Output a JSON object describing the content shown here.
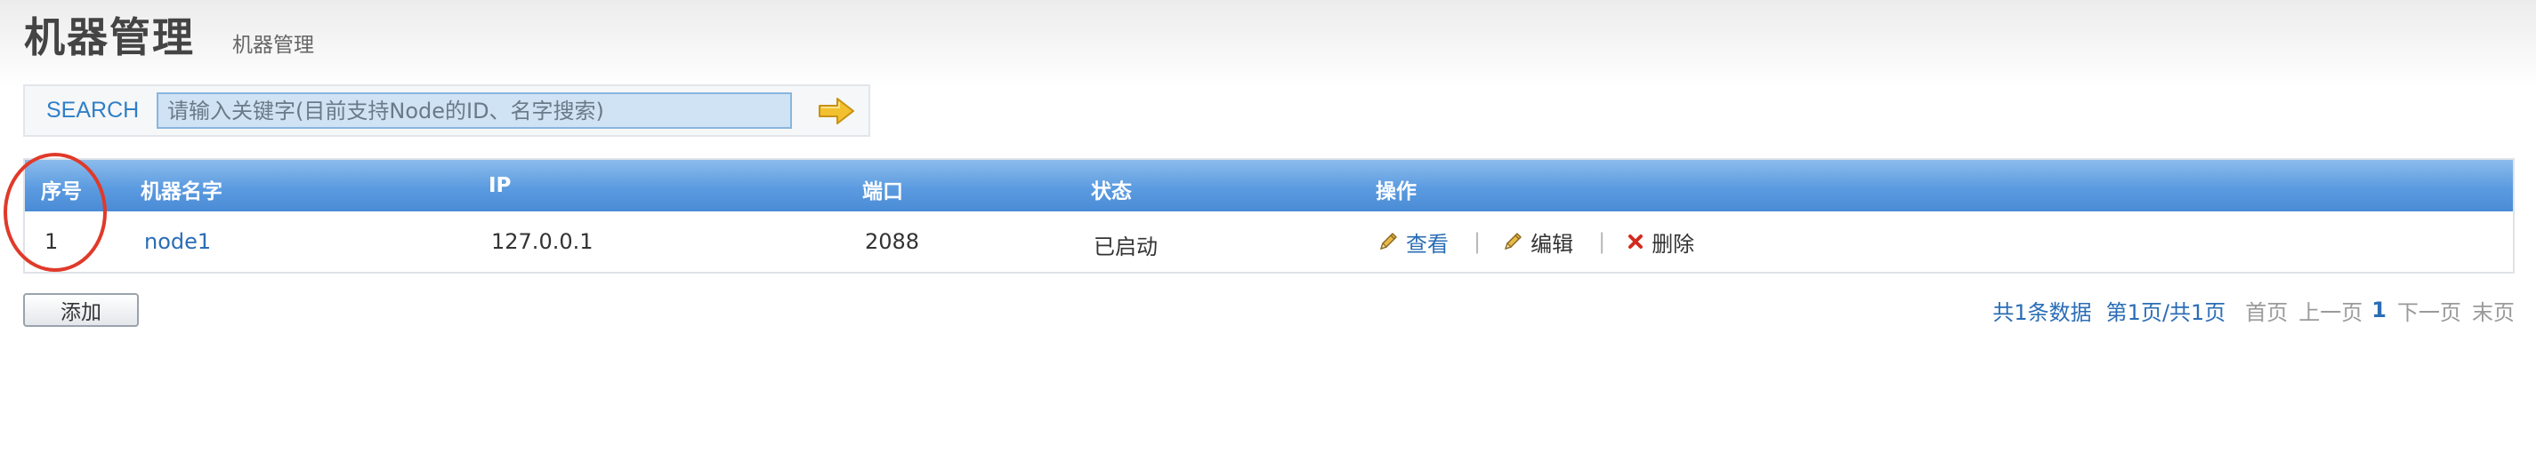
{
  "header": {
    "title": "机器管理",
    "subtitle": "机器管理"
  },
  "search": {
    "label": "SEARCH",
    "placeholder": "请输入关键字(目前支持Node的ID、名字搜索)",
    "go_icon": "arrow-right-icon"
  },
  "table": {
    "columns": [
      "序号",
      "机器名字",
      "IP",
      "端口",
      "状态",
      "操作"
    ],
    "rows": [
      {
        "index": "1",
        "name": "node1",
        "ip": "127.0.0.1",
        "port": "2088",
        "status": "已启动",
        "actions": {
          "view": "查看",
          "edit": "编辑",
          "delete": "删除",
          "separator": "|"
        }
      }
    ]
  },
  "footer": {
    "add_label": "添加",
    "pagination": {
      "total": "共1条数据",
      "page_info": "第1页/共1页",
      "first": "首页",
      "prev": "上一页",
      "current": "1",
      "next": "下一页",
      "last": "末页"
    }
  },
  "colors": {
    "accent": "#2a6db5",
    "header_bar": "#5b9be0",
    "annotation": "#e03a2a"
  }
}
